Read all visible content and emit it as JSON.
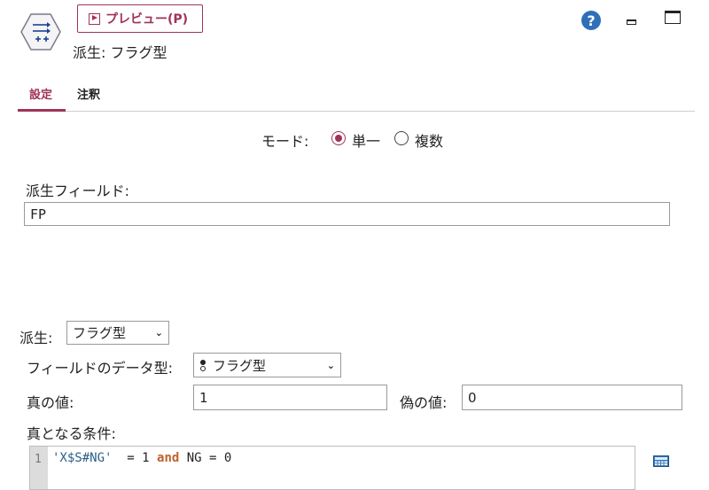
{
  "header": {
    "preview_label": "プレビュー(P)",
    "node_title": "派生: フラグ型",
    "help_glyph": "?"
  },
  "tabs": [
    {
      "label": "設定",
      "active": true
    },
    {
      "label": "注釈",
      "active": false
    }
  ],
  "mode": {
    "label": "モード:",
    "options": [
      "単一",
      "複数"
    ],
    "selected": "単一"
  },
  "derive_field": {
    "label": "派生フィールド:",
    "value": "FP"
  },
  "derive_as": {
    "label": "派生:",
    "value": "フラグ型"
  },
  "field_type": {
    "label": "フィールドのデータ型:",
    "value": "フラグ型",
    "icon": "flag-type-icon"
  },
  "true_value": {
    "label": "真の値:",
    "value": "1"
  },
  "false_value": {
    "label": "偽の値:",
    "value": "0"
  },
  "condition": {
    "label": "真となる条件:",
    "line_number": "1",
    "tokens": {
      "string": "'X$S#NG'",
      "op1": "  = 1 ",
      "keyword": "and",
      "rest": " NG = 0"
    }
  },
  "colors": {
    "accent": "#a0325a",
    "help": "#2f6fb9",
    "keyword": "#c0622c",
    "string": "#2c5f8a"
  }
}
